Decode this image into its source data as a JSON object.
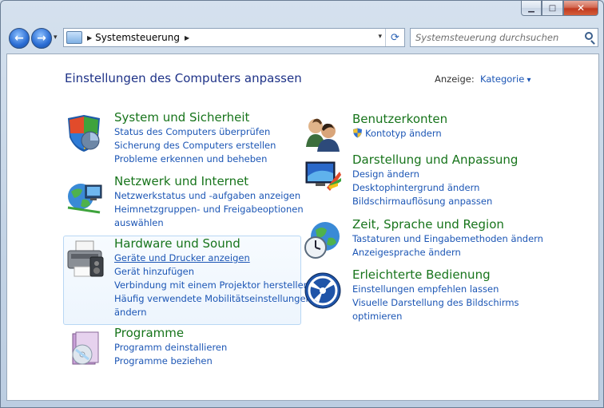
{
  "window": {
    "minimize_glyph": "▁",
    "maximize_glyph": "□",
    "close_glyph": "✕"
  },
  "nav": {
    "back_glyph": "←",
    "forward_glyph": "→",
    "recent_glyph": "▾",
    "breadcrumb": [
      "Systemsteuerung"
    ],
    "crumb_sep": "▶",
    "refresh_glyph": "⟳",
    "address_dropdown_glyph": "▾"
  },
  "search": {
    "placeholder": "Systemsteuerung durchsuchen",
    "value": ""
  },
  "main": {
    "title": "Einstellungen des Computers anpassen",
    "view_label": "Anzeige:",
    "view_value": "Kategorie"
  },
  "categories_left": [
    {
      "title": "System und Sicherheit",
      "icon": "shield-icon",
      "links": [
        "Status des Computers überprüfen",
        "Sicherung des Computers erstellen",
        "Probleme erkennen und beheben"
      ]
    },
    {
      "title": "Netzwerk und Internet",
      "icon": "network-icon",
      "links": [
        "Netzwerkstatus und -aufgaben anzeigen",
        "Heimnetzgruppen- und Freigabeoptionen",
        "auswählen"
      ]
    },
    {
      "title": "Hardware und Sound",
      "icon": "printer-icon",
      "links": [
        "Geräte und Drucker anzeigen",
        "Gerät hinzufügen",
        "Verbindung mit einem Projektor herstellen",
        "Häufig verwendete Mobilitätseinstellungen",
        "ändern"
      ]
    },
    {
      "title": "Programme",
      "icon": "programs-icon",
      "links": [
        "Programm deinstallieren",
        "Programme beziehen"
      ]
    }
  ],
  "categories_right": [
    {
      "title": "Benutzerkonten",
      "icon": "users-icon",
      "links": [
        "Kontotyp ändern"
      ]
    },
    {
      "title": "Darstellung und Anpassung",
      "icon": "display-icon",
      "links": [
        "Design ändern",
        "Desktophintergrund ändern",
        "Bildschirmauflösung anpassen"
      ]
    },
    {
      "title": "Zeit, Sprache und Region",
      "icon": "globe-clock-icon",
      "links": [
        "Tastaturen und Eingabemethoden ändern",
        "Anzeigesprache ändern"
      ]
    },
    {
      "title": "Erleichterte Bedienung",
      "icon": "accessibility-icon",
      "links": [
        "Einstellungen empfehlen lassen",
        "Visuelle Darstellung des Bildschirms",
        "optimieren"
      ]
    }
  ]
}
